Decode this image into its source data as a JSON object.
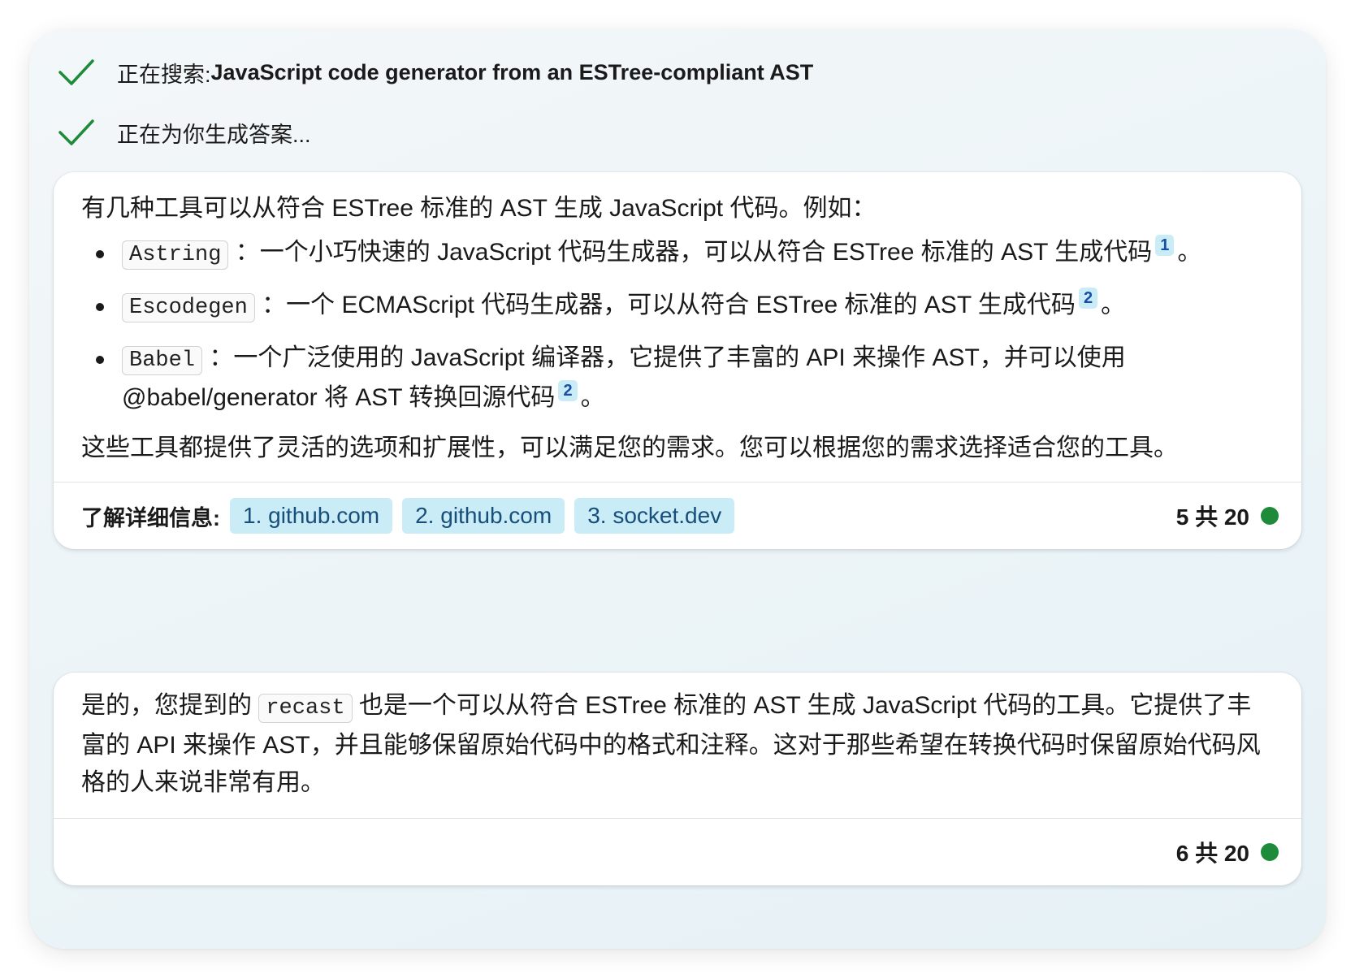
{
  "status": {
    "search_prefix": "正在搜索: ",
    "search_query": "JavaScript code generator from an ESTree-compliant AST",
    "generating": "正在为你生成答案..."
  },
  "answer1": {
    "intro": "有几种工具可以从符合 ESTree 标准的 AST 生成 JavaScript 代码。例如：",
    "items": [
      {
        "code": "Astring",
        "text": "：一个小巧快速的 JavaScript 代码生成器，可以从符合 ESTree 标准的 AST 生成代码",
        "cite": "1",
        "end": "。"
      },
      {
        "code": "Escodegen",
        "text": "：一个 ECMAScript 代码生成器，可以从符合 ESTree 标准的 AST 生成代码",
        "cite": "2",
        "end": "。"
      },
      {
        "code": "Babel",
        "text": "：一个广泛使用的 JavaScript 编译器，它提供了丰富的 API 来操作 AST，并可以使用 @babel/generator 将 AST 转换回源代码",
        "cite": "2",
        "end": "。"
      }
    ],
    "conclusion": "这些工具都提供了灵活的选项和扩展性，可以满足您的需求。您可以根据您的需求选择适合您的工具。",
    "learn_more_label": "了解详细信息:",
    "sources": [
      "1. github.com",
      "2. github.com",
      "3. socket.dev"
    ],
    "counter": "5 共 20",
    "counter_color": "#1d8b3a"
  },
  "answer2": {
    "text_before": "是的，您提到的",
    "code": "recast",
    "text_after": "也是一个可以从符合 ESTree 标准的 AST 生成 JavaScript 代码的工具。它提供了丰富的 API 来操作 AST，并且能够保留原始代码中的格式和注释。这对于那些希望在转换代码时保留原始代码风格的人来说非常有用。",
    "counter": "6 共 20"
  },
  "icons": {
    "check": "check-icon",
    "check_color": "#1d8b3a",
    "status_dot": "status-dot"
  }
}
